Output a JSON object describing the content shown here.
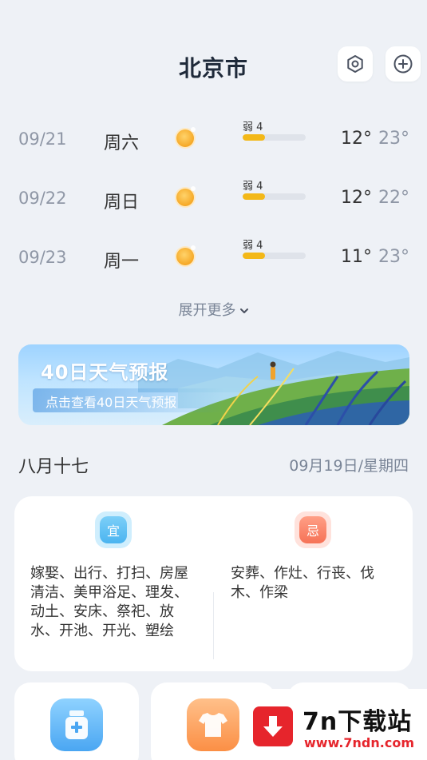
{
  "header": {
    "city": "北京市",
    "settings_icon": "settings-icon",
    "add_icon": "plus-icon"
  },
  "forecast": [
    {
      "date": "09/21",
      "weekday": "周六",
      "icon": "sunny-icon",
      "wind": "弱 4",
      "wind_level": 0.35,
      "low": "12°",
      "high": "23°"
    },
    {
      "date": "09/22",
      "weekday": "周日",
      "icon": "sunny-icon",
      "wind": "弱 4",
      "wind_level": 0.35,
      "low": "12°",
      "high": "22°"
    },
    {
      "date": "09/23",
      "weekday": "周一",
      "icon": "sunny-icon",
      "wind": "弱 4",
      "wind_level": 0.35,
      "low": "11°",
      "high": "23°"
    }
  ],
  "expand_label": "展开更多",
  "banner": {
    "title": "40日天气预报",
    "subtitle": "点击查看40日天气预报"
  },
  "almanac": {
    "lunar": "八月十七",
    "solar": "09月19日/星期四",
    "yi_label": "宜",
    "ji_label": "忌",
    "yi_text": "嫁娶、出行、打扫、房屋清洁、美甲浴足、理发、动土、安床、祭祀、放水、开池、开光、塑绘",
    "ji_text": "安葬、作灶、行丧、伐木、作梁"
  },
  "tools": [
    {
      "icon": "medicine-icon"
    },
    {
      "icon": "clothing-icon"
    },
    {
      "icon": ""
    }
  ],
  "watermark": {
    "name": "7n下载站",
    "url": "www.7ndn.com"
  },
  "colors": {
    "background": "#eef1f6",
    "wind_bar": "#f3b818",
    "accent_blue": "#4bb4f0",
    "accent_red": "#f67256"
  }
}
